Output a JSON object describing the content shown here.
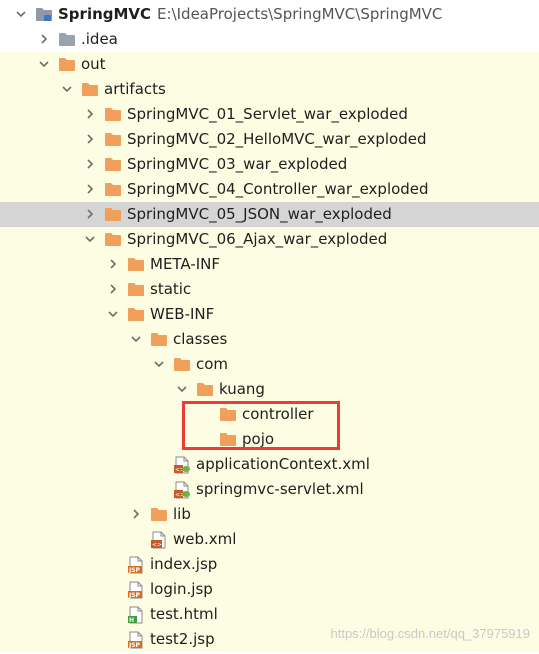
{
  "colors": {
    "folder": "#f0a05a",
    "folder_muted": "#9aa3ad",
    "selection": "#d5d5d5",
    "excluded_bg": "#fdfde4",
    "highlight_box": "#ee3b35",
    "jsp_badge": "#d9701f",
    "html_badge": "#3f9d3f"
  },
  "tree": {
    "items": [
      {
        "label": "SpringMVC",
        "path": "E:\\IdeaProjects\\SpringMVC\\SpringMVC",
        "icon": "module-icon",
        "toggle": "expanded",
        "depth": 0,
        "state": "normal"
      },
      {
        "label": ".idea",
        "icon": "folder-grey-icon",
        "toggle": "collapsed",
        "depth": 1,
        "state": "normal"
      },
      {
        "label": "out",
        "icon": "folder-icon",
        "toggle": "expanded",
        "depth": 1,
        "state": "excluded"
      },
      {
        "label": "artifacts",
        "icon": "folder-icon",
        "toggle": "expanded",
        "depth": 2,
        "state": "excluded"
      },
      {
        "label": "SpringMVC_01_Servlet_war_exploded",
        "icon": "folder-icon",
        "toggle": "collapsed",
        "depth": 3,
        "state": "excluded"
      },
      {
        "label": "SpringMVC_02_HelloMVC_war_exploded",
        "icon": "folder-icon",
        "toggle": "collapsed",
        "depth": 3,
        "state": "excluded"
      },
      {
        "label": "SpringMVC_03_war_exploded",
        "icon": "folder-icon",
        "toggle": "collapsed",
        "depth": 3,
        "state": "excluded"
      },
      {
        "label": "SpringMVC_04_Controller_war_exploded",
        "icon": "folder-icon",
        "toggle": "collapsed",
        "depth": 3,
        "state": "excluded"
      },
      {
        "label": "SpringMVC_05_JSON_war_exploded",
        "icon": "folder-icon",
        "toggle": "collapsed",
        "depth": 3,
        "state": "selected"
      },
      {
        "label": "SpringMVC_06_Ajax_war_exploded",
        "icon": "folder-icon",
        "toggle": "expanded",
        "depth": 3,
        "state": "excluded"
      },
      {
        "label": "META-INF",
        "icon": "folder-icon",
        "toggle": "collapsed",
        "depth": 4,
        "state": "excluded"
      },
      {
        "label": "static",
        "icon": "folder-icon",
        "toggle": "collapsed",
        "depth": 4,
        "state": "excluded"
      },
      {
        "label": "WEB-INF",
        "icon": "folder-icon",
        "toggle": "expanded",
        "depth": 4,
        "state": "excluded"
      },
      {
        "label": "classes",
        "icon": "folder-icon",
        "toggle": "expanded",
        "depth": 5,
        "state": "excluded"
      },
      {
        "label": "com",
        "icon": "folder-icon",
        "toggle": "expanded",
        "depth": 6,
        "state": "excluded"
      },
      {
        "label": "kuang",
        "icon": "folder-icon",
        "toggle": "expanded",
        "depth": 7,
        "state": "excluded"
      },
      {
        "label": "controller",
        "icon": "folder-icon",
        "toggle": "none",
        "depth": 8,
        "state": "excluded"
      },
      {
        "label": "pojo",
        "icon": "folder-icon",
        "toggle": "none",
        "depth": 8,
        "state": "excluded"
      },
      {
        "label": "applicationContext.xml",
        "icon": "spring-xml-icon",
        "toggle": "none",
        "depth": 6,
        "state": "excluded"
      },
      {
        "label": "springmvc-servlet.xml",
        "icon": "spring-xml-icon",
        "toggle": "none",
        "depth": 6,
        "state": "excluded"
      },
      {
        "label": "lib",
        "icon": "folder-icon",
        "toggle": "collapsed",
        "depth": 5,
        "state": "excluded"
      },
      {
        "label": "web.xml",
        "icon": "xml-file-icon",
        "toggle": "none",
        "depth": 5,
        "state": "excluded"
      },
      {
        "label": "index.jsp",
        "icon": "jsp-file-icon",
        "toggle": "none",
        "depth": 4,
        "state": "excluded"
      },
      {
        "label": "login.jsp",
        "icon": "jsp-file-icon",
        "toggle": "none",
        "depth": 4,
        "state": "excluded"
      },
      {
        "label": "test.html",
        "icon": "html-file-icon",
        "toggle": "none",
        "depth": 4,
        "state": "excluded"
      },
      {
        "label": "test2.jsp",
        "icon": "jsp-file-icon",
        "toggle": "none",
        "depth": 4,
        "state": "excluded"
      }
    ]
  },
  "watermark": "https://blog.csdn.net/qq_37975919"
}
